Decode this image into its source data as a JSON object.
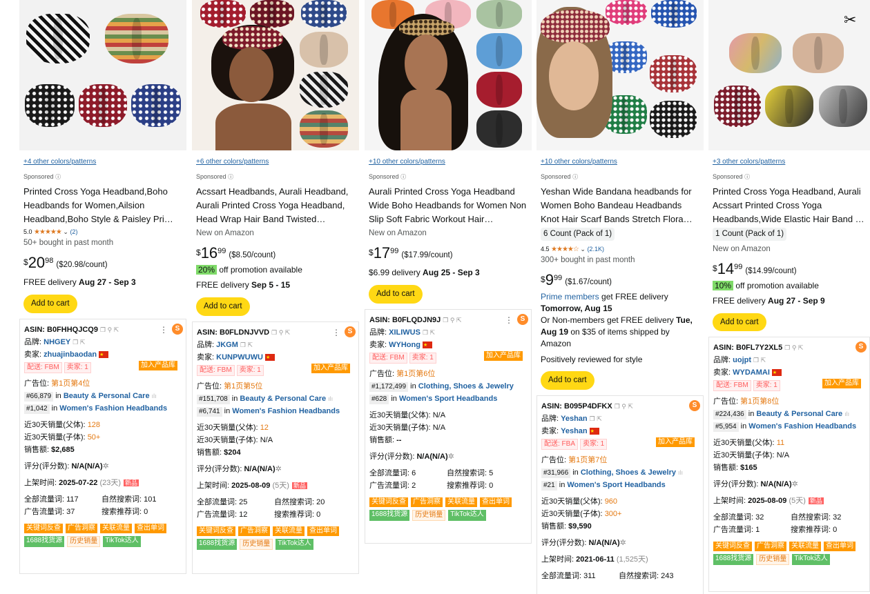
{
  "products": [
    {
      "colors_link": "+4 other colors/patterns",
      "sponsored": "Sponsored",
      "title": "Printed Cross Yoga Headband,Boho Headbands for Women,Ailsion Headband,Boho Style & Paisley Pri…",
      "rating_value": "5.0",
      "stars": "★★★★★",
      "rating_count": "(2)",
      "bought": "50+ bought in past month",
      "price_int": "20",
      "price_frac": "98",
      "per_count": "($20.98/count)",
      "delivery_prefix": "FREE delivery ",
      "delivery_date": "Aug 27 - Sep 3",
      "add_to_cart": "Add to cart",
      "asin": "ASIN: B0FHHQJCQ9",
      "brand_label": "品牌:",
      "brand": "NHGEY",
      "seller_label": "卖家:",
      "seller": "zhuajinbaodan",
      "ship": "配送: FBM",
      "seller_count": "卖家: 1",
      "add_lib": "加入产品库",
      "ad_pos_label": "广告位:",
      "ad_pos": "第1页第4位",
      "rank1": "#66,879",
      "rank1_cat": "Beauty & Personal Care",
      "rank2": "#1,042",
      "rank2_cat": "Women's Fashion Headbands",
      "sales_parent_label": "近30天销量(父体):",
      "sales_parent": "128",
      "sales_child_label": "近30天销量(子体):",
      "sales_child": "50+",
      "revenue_label": "销售额:",
      "revenue": "$2,685",
      "review_label": "评分(评分数):",
      "review": "N/A(N/A)",
      "launch_label": "上架时间:",
      "launch": "2025-07-22",
      "launch_days": "(23天)",
      "new_tag": "新品",
      "traffic_all": "全部流量词: 117",
      "traffic_natural": "自然搜索词: 101",
      "traffic_ad": "广告流量词: 37",
      "traffic_rec": "搜索推荐词: 0"
    },
    {
      "colors_link": "+6 other colors/patterns",
      "sponsored": "Sponsored",
      "title": "Acssart Headbands, Aurali Headband, Aurali Printed Cross Yoga Headband, Head Wrap Hair Band Twisted…",
      "new_on": "New on Amazon",
      "price_int": "16",
      "price_frac": "99",
      "per_count": "($8.50/count)",
      "promo_pct": "20%",
      "promo_text": " off promotion available",
      "delivery_prefix": "FREE delivery ",
      "delivery_date": "Sep 5 - 15",
      "add_to_cart": "Add to cart",
      "asin": "ASIN: B0FLDNJVVD",
      "brand_label": "品牌:",
      "brand": "JKGM",
      "seller_label": "卖家:",
      "seller": "KUNPWUWU",
      "ship": "配送: FBM",
      "seller_count": "卖家: 1",
      "add_lib": "加入产品库",
      "ad_pos_label": "广告位:",
      "ad_pos": "第1页第5位",
      "rank1": "#151,708",
      "rank1_cat": "Beauty & Personal Care",
      "rank2": "#6,741",
      "rank2_cat": "Women's Fashion Headbands",
      "sales_parent_label": "近30天销量(父体):",
      "sales_parent": "12",
      "sales_child_label": "近30天销量(子体):",
      "sales_child": "N/A",
      "revenue_label": "销售额:",
      "revenue": "$204",
      "review_label": "评分(评分数):",
      "review": "N/A(N/A)",
      "launch_label": "上架时间:",
      "launch": "2025-08-09",
      "launch_days": "(5天)",
      "new_tag": "新品",
      "traffic_all": "全部流量词: 25",
      "traffic_natural": "自然搜索词: 20",
      "traffic_ad": "广告流量词: 12",
      "traffic_rec": "搜索推荐词: 0"
    },
    {
      "colors_link": "+10 other colors/patterns",
      "sponsored": "Sponsored",
      "title": "Aurali Printed Cross Yoga Headband Wide Boho Headbands for Women Non Slip Soft Fabric Workout Hair…",
      "new_on": "New on Amazon",
      "price_int": "17",
      "price_frac": "99",
      "per_count": "($17.99/count)",
      "delivery_prefix": "$6.99 delivery ",
      "delivery_date": "Aug 25 - Sep 3",
      "add_to_cart": "Add to cart",
      "asin": "ASIN: B0FLQDJN9J",
      "brand_label": "品牌:",
      "brand": "XILIWUS",
      "seller_label": "卖家:",
      "seller": "WYHong",
      "ship": "配送: FBM",
      "seller_count": "卖家: 1",
      "add_lib": "加入产品库",
      "ad_pos_label": "广告位:",
      "ad_pos": "第1页第6位",
      "rank1": "#1,172,499",
      "rank1_cat": "Clothing, Shoes & Jewelry",
      "rank2": "#628",
      "rank2_cat": "Women's Sport Headbands",
      "sales_parent_label": "近30天销量(父体):",
      "sales_parent": "N/A",
      "sales_child_label": "近30天销量(子体):",
      "sales_child": "N/A",
      "revenue_label": "销售额:",
      "revenue": "--",
      "review_label": "评分(评分数):",
      "review": "N/A(N/A)",
      "traffic_all": "全部流量词: 6",
      "traffic_natural": "自然搜索词: 5",
      "traffic_ad": "广告流量词: 2",
      "traffic_rec": "搜索推荐词: 0"
    },
    {
      "colors_link": "+10 other colors/patterns",
      "sponsored": "Sponsored",
      "title": "Yeshan Wide Bandana headbands for Women Boho Bandeau Headbands Knot Hair Scarf Bands Stretch Flora…",
      "pack": "6 Count (Pack of 1)",
      "rating_value": "4.5",
      "stars": "★★★★☆",
      "rating_count": "(2.1K)",
      "bought": "300+ bought in past month",
      "price_int": "9",
      "price_frac": "99",
      "per_count": "($1.67/count)",
      "prime_members": "Prime members",
      "prime_rest": " get FREE delivery",
      "prime_date": "Tomorrow, Aug 15",
      "non_members_a": "Or Non-members get FREE delivery ",
      "non_members_date": "Tue, Aug 19",
      "non_members_b": " on $35 of items shipped by Amazon",
      "positively": "Positively reviewed for style",
      "add_to_cart": "Add to cart",
      "asin": "ASIN: B095P4DFKX",
      "brand_label": "品牌:",
      "brand": "Yeshan",
      "seller_label": "卖家:",
      "seller": "Yeshan",
      "ship": "配送: FBA",
      "seller_count": "卖家: 1",
      "add_lib": "加入产品库",
      "ad_pos_label": "广告位:",
      "ad_pos": "第1页第7位",
      "rank1": "#31,966",
      "rank1_cat": "Clothing, Shoes & Jewelry",
      "rank2": "#21",
      "rank2_cat": "Women's Sport Headbands",
      "sales_parent_label": "近30天销量(父体):",
      "sales_parent": "960",
      "sales_child_label": "近30天销量(子体):",
      "sales_child": "300+",
      "revenue_label": "销售额:",
      "revenue": "$9,590",
      "review_label": "评分(评分数):",
      "review": "N/A(N/A)",
      "launch_label": "上架时间:",
      "launch": "2021-06-11",
      "launch_days": "(1,525天)",
      "traffic_all": "全部流量词: 311",
      "traffic_natural": "自然搜索词: 243"
    },
    {
      "colors_link": "+3 other colors/patterns",
      "sponsored": "Sponsored",
      "title": "Printed Cross Yoga Headband, Aurali Acssart Printed Cross Yoga Headbands,Wide Elastic Hair Band …",
      "pack": "1 Count (Pack of 1)",
      "new_on": "New on Amazon",
      "price_int": "14",
      "price_frac": "99",
      "per_count": "($14.99/count)",
      "promo_pct": "10%",
      "promo_text": " off promotion available",
      "delivery_prefix": "FREE delivery ",
      "delivery_date": "Aug 27 - Sep 9",
      "add_to_cart": "Add to cart",
      "asin": "ASIN: B0FL7Y2XL5",
      "brand_label": "品牌:",
      "brand": "uojpt",
      "seller_label": "卖家:",
      "seller": "WYDAMAI",
      "ship": "配送: FBM",
      "seller_count": "卖家: 1",
      "add_lib": "加入产品库",
      "ad_pos_label": "广告位:",
      "ad_pos": "第1页第8位",
      "rank1": "#224,436",
      "rank1_cat": "Beauty & Personal Care",
      "rank2": "#5,954",
      "rank2_cat": "Women's Fashion Headbands",
      "sales_parent_label": "近30天销量(父体):",
      "sales_parent": "11",
      "sales_child_label": "近30天销量(子体):",
      "sales_child": "N/A",
      "revenue_label": "销售额:",
      "revenue": "$165",
      "review_label": "评分(评分数):",
      "review": "N/A(N/A)",
      "launch_label": "上架时间:",
      "launch": "2025-08-09",
      "launch_days": "(5天)",
      "new_tag": "新品",
      "traffic_all": "全部流量词: 32",
      "traffic_natural": "自然搜索词: 32",
      "traffic_ad": "广告流量词: 1",
      "traffic_rec": "搜索推荐词: 0"
    }
  ],
  "tags": {
    "keyword_reverse": "关键词反查",
    "ad_insight": "广告洞察",
    "related_traffic": "关联流量",
    "check_words": "查出单词",
    "source_1688": "1688找货源",
    "history_sales": "历史销量",
    "tiktok": "TikTok达人"
  },
  "currency": "$",
  "in_word": "in",
  "colors": {
    "accent_link": "#2162a1",
    "add_to_cart": "#ffd814",
    "star": "#de7921",
    "ad_pos": "#e47911",
    "promo": "#7fda69"
  }
}
